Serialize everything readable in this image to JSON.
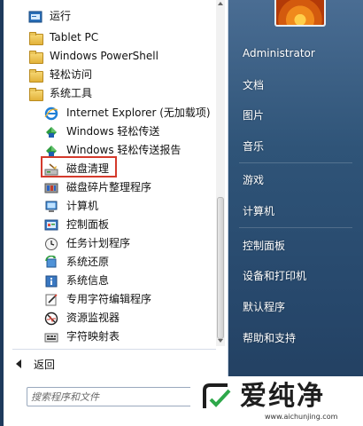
{
  "programs": [
    {
      "label": "运行",
      "icon": "run-icon"
    },
    {
      "label": "Tablet PC",
      "icon": "folder-icon"
    },
    {
      "label": "Windows PowerShell",
      "icon": "folder-icon"
    },
    {
      "label": "轻松访问",
      "icon": "folder-icon"
    },
    {
      "label": "系统工具",
      "icon": "folder-icon"
    },
    {
      "label": "Internet Explorer (无加载项)",
      "icon": "internet-explorer-icon"
    },
    {
      "label": "Windows 轻松传送",
      "icon": "easy-transfer-icon"
    },
    {
      "label": "Windows 轻松传送报告",
      "icon": "easy-transfer-report-icon"
    },
    {
      "label": "磁盘清理",
      "icon": "disk-cleanup-icon"
    },
    {
      "label": "磁盘碎片整理程序",
      "icon": "disk-defragmenter-icon"
    },
    {
      "label": "计算机",
      "icon": "computer-icon"
    },
    {
      "label": "控制面板",
      "icon": "control-panel-icon"
    },
    {
      "label": "任务计划程序",
      "icon": "task-scheduler-icon"
    },
    {
      "label": "系统还原",
      "icon": "system-restore-icon"
    },
    {
      "label": "系统信息",
      "icon": "system-information-icon"
    },
    {
      "label": "专用字符编辑程序",
      "icon": "private-character-editor-icon"
    },
    {
      "label": "资源监视器",
      "icon": "resource-monitor-icon"
    },
    {
      "label": "字符映射表",
      "icon": "character-map-icon"
    }
  ],
  "back_label": "返回",
  "search": {
    "placeholder": "搜索程序和文件"
  },
  "right_items": [
    "Administrator",
    "文档",
    "图片",
    "音乐",
    "游戏",
    "计算机",
    "控制面板",
    "设备和打印机",
    "默认程序",
    "帮助和支持"
  ],
  "watermark": {
    "text": "爱纯净",
    "url": "www.aichunjing.com"
  },
  "colors": {
    "highlight": "#d43a2c",
    "panel_dark": "#2f5478"
  }
}
